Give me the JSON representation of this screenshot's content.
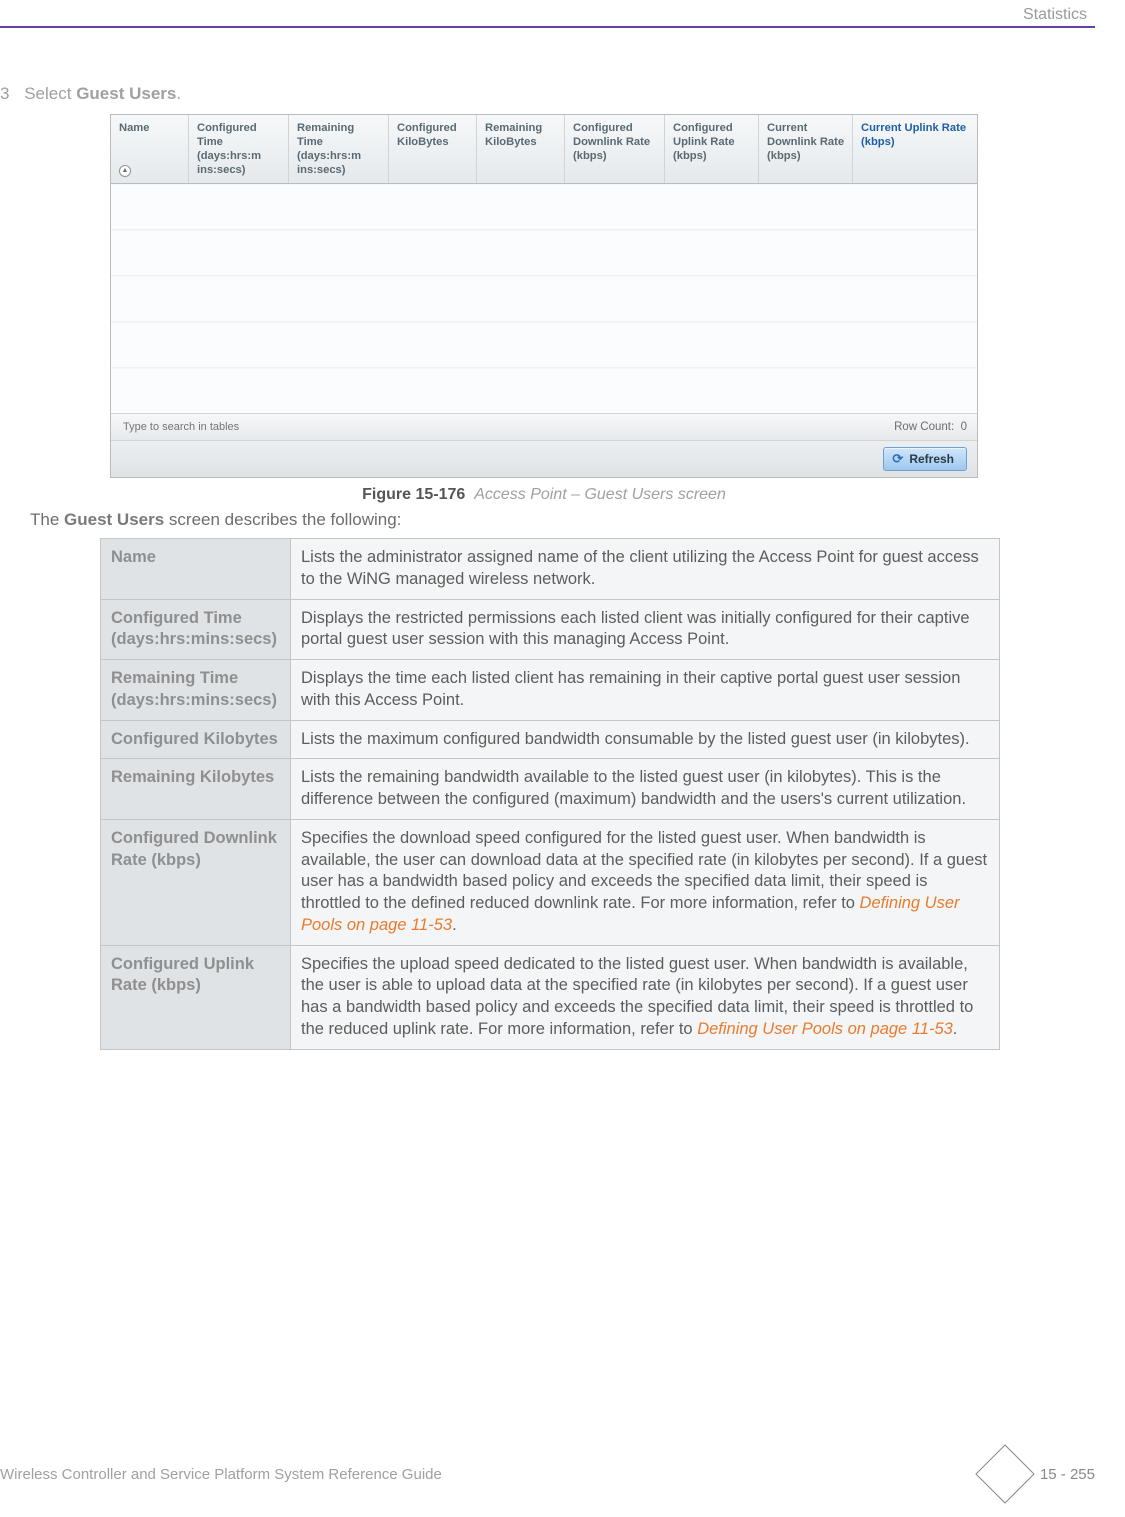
{
  "header": {
    "section": "Statistics"
  },
  "step": {
    "number": "3",
    "prefix": "Select ",
    "bold": "Guest Users",
    "suffix": "."
  },
  "screenshot": {
    "columns": [
      "Name",
      "Configured Time (days:hrs:m ins:secs)",
      "Remaining Time (days:hrs:m ins:secs)",
      "Configured KiloBytes",
      "Remaining KiloBytes",
      "Configured Downlink Rate (kbps)",
      "Configured Uplink Rate (kbps)",
      "Current Downlink Rate (kbps)",
      "Current Uplink Rate (kbps)"
    ],
    "search_placeholder": "Type to search in tables",
    "row_count_label": "Row Count:",
    "row_count_value": "0",
    "refresh_label": "Refresh"
  },
  "figure": {
    "label": "Figure 15-176",
    "caption": "Access Point – Guest Users screen"
  },
  "intro": {
    "pre": "The ",
    "bold": "Guest Users",
    "post": " screen describes the following:"
  },
  "defs": [
    {
      "term": "Name",
      "desc": "Lists the administrator assigned name of the client utilizing the Access Point for guest access to the WiNG managed wireless network."
    },
    {
      "term": "Configured Time (days:hrs:mins:secs)",
      "desc": "Displays the restricted permissions each listed client was initially configured for their captive portal guest user session with this managing Access Point."
    },
    {
      "term": "Remaining Time (days:hrs:mins:secs)",
      "desc": "Displays the time each listed client has remaining in their captive portal guest user session with this Access Point."
    },
    {
      "term": "Configured Kilobytes",
      "desc": "Lists the maximum configured bandwidth consumable by the listed guest user (in kilobytes)."
    },
    {
      "term": "Remaining Kilobytes",
      "desc": "Lists the remaining bandwidth available to the listed guest user (in kilobytes). This is the difference between the configured (maximum) bandwidth and the users's current utilization."
    },
    {
      "term": "Configured Downlink Rate (kbps)",
      "desc_pre": "Specifies the download speed configured for the listed guest user. When bandwidth is available, the user can download data at the specified rate (in kilobytes per second). If a guest user has a bandwidth based policy and exceeds the specified data limit, their speed is throttled to the defined reduced downlink rate. For more information, refer to ",
      "xref": "Defining User Pools on page 11-53",
      "desc_post": "."
    },
    {
      "term": "Configured Uplink Rate (kbps)",
      "desc_pre": "Specifies the upload speed dedicated to the listed guest user. When bandwidth is available, the user is able to upload data at the specified rate (in kilobytes per second). If a guest user has a bandwidth based policy and exceeds the specified data limit, their speed is throttled to the reduced uplink rate. For more information, refer to ",
      "xref": "Defining User Pools on page 11-53",
      "desc_post": "."
    }
  ],
  "footer": {
    "left": "Wireless Controller and Service Platform System Reference Guide",
    "page": "15 - 255"
  }
}
